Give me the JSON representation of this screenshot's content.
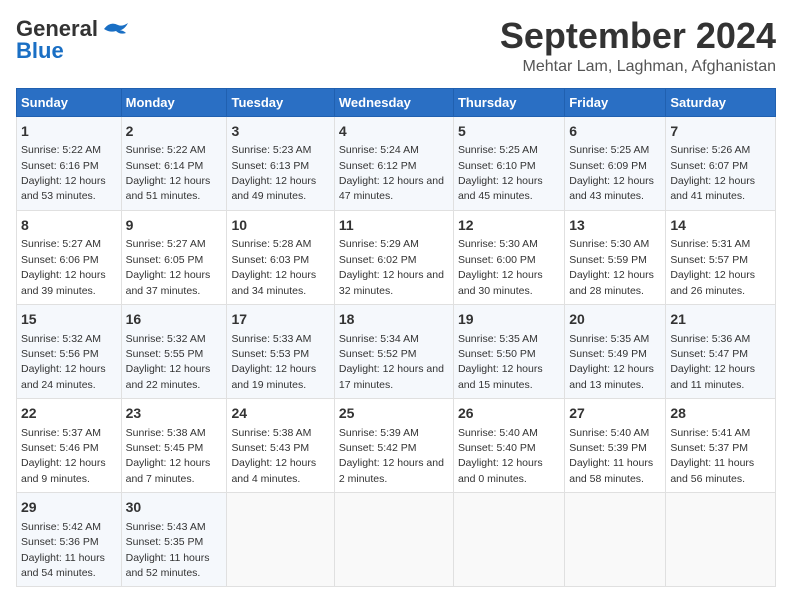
{
  "logo": {
    "line1": "General",
    "line2": "Blue"
  },
  "title": "September 2024",
  "location": "Mehtar Lam, Laghman, Afghanistan",
  "days_of_week": [
    "Sunday",
    "Monday",
    "Tuesday",
    "Wednesday",
    "Thursday",
    "Friday",
    "Saturday"
  ],
  "weeks": [
    [
      {
        "day": "1",
        "sunrise": "5:22 AM",
        "sunset": "6:16 PM",
        "daylight": "12 hours and 53 minutes."
      },
      {
        "day": "2",
        "sunrise": "5:22 AM",
        "sunset": "6:14 PM",
        "daylight": "12 hours and 51 minutes."
      },
      {
        "day": "3",
        "sunrise": "5:23 AM",
        "sunset": "6:13 PM",
        "daylight": "12 hours and 49 minutes."
      },
      {
        "day": "4",
        "sunrise": "5:24 AM",
        "sunset": "6:12 PM",
        "daylight": "12 hours and 47 minutes."
      },
      {
        "day": "5",
        "sunrise": "5:25 AM",
        "sunset": "6:10 PM",
        "daylight": "12 hours and 45 minutes."
      },
      {
        "day": "6",
        "sunrise": "5:25 AM",
        "sunset": "6:09 PM",
        "daylight": "12 hours and 43 minutes."
      },
      {
        "day": "7",
        "sunrise": "5:26 AM",
        "sunset": "6:07 PM",
        "daylight": "12 hours and 41 minutes."
      }
    ],
    [
      {
        "day": "8",
        "sunrise": "5:27 AM",
        "sunset": "6:06 PM",
        "daylight": "12 hours and 39 minutes."
      },
      {
        "day": "9",
        "sunrise": "5:27 AM",
        "sunset": "6:05 PM",
        "daylight": "12 hours and 37 minutes."
      },
      {
        "day": "10",
        "sunrise": "5:28 AM",
        "sunset": "6:03 PM",
        "daylight": "12 hours and 34 minutes."
      },
      {
        "day": "11",
        "sunrise": "5:29 AM",
        "sunset": "6:02 PM",
        "daylight": "12 hours and 32 minutes."
      },
      {
        "day": "12",
        "sunrise": "5:30 AM",
        "sunset": "6:00 PM",
        "daylight": "12 hours and 30 minutes."
      },
      {
        "day": "13",
        "sunrise": "5:30 AM",
        "sunset": "5:59 PM",
        "daylight": "12 hours and 28 minutes."
      },
      {
        "day": "14",
        "sunrise": "5:31 AM",
        "sunset": "5:57 PM",
        "daylight": "12 hours and 26 minutes."
      }
    ],
    [
      {
        "day": "15",
        "sunrise": "5:32 AM",
        "sunset": "5:56 PM",
        "daylight": "12 hours and 24 minutes."
      },
      {
        "day": "16",
        "sunrise": "5:32 AM",
        "sunset": "5:55 PM",
        "daylight": "12 hours and 22 minutes."
      },
      {
        "day": "17",
        "sunrise": "5:33 AM",
        "sunset": "5:53 PM",
        "daylight": "12 hours and 19 minutes."
      },
      {
        "day": "18",
        "sunrise": "5:34 AM",
        "sunset": "5:52 PM",
        "daylight": "12 hours and 17 minutes."
      },
      {
        "day": "19",
        "sunrise": "5:35 AM",
        "sunset": "5:50 PM",
        "daylight": "12 hours and 15 minutes."
      },
      {
        "day": "20",
        "sunrise": "5:35 AM",
        "sunset": "5:49 PM",
        "daylight": "12 hours and 13 minutes."
      },
      {
        "day": "21",
        "sunrise": "5:36 AM",
        "sunset": "5:47 PM",
        "daylight": "12 hours and 11 minutes."
      }
    ],
    [
      {
        "day": "22",
        "sunrise": "5:37 AM",
        "sunset": "5:46 PM",
        "daylight": "12 hours and 9 minutes."
      },
      {
        "day": "23",
        "sunrise": "5:38 AM",
        "sunset": "5:45 PM",
        "daylight": "12 hours and 7 minutes."
      },
      {
        "day": "24",
        "sunrise": "5:38 AM",
        "sunset": "5:43 PM",
        "daylight": "12 hours and 4 minutes."
      },
      {
        "day": "25",
        "sunrise": "5:39 AM",
        "sunset": "5:42 PM",
        "daylight": "12 hours and 2 minutes."
      },
      {
        "day": "26",
        "sunrise": "5:40 AM",
        "sunset": "5:40 PM",
        "daylight": "12 hours and 0 minutes."
      },
      {
        "day": "27",
        "sunrise": "5:40 AM",
        "sunset": "5:39 PM",
        "daylight": "11 hours and 58 minutes."
      },
      {
        "day": "28",
        "sunrise": "5:41 AM",
        "sunset": "5:37 PM",
        "daylight": "11 hours and 56 minutes."
      }
    ],
    [
      {
        "day": "29",
        "sunrise": "5:42 AM",
        "sunset": "5:36 PM",
        "daylight": "11 hours and 54 minutes."
      },
      {
        "day": "30",
        "sunrise": "5:43 AM",
        "sunset": "5:35 PM",
        "daylight": "11 hours and 52 minutes."
      },
      null,
      null,
      null,
      null,
      null
    ]
  ]
}
